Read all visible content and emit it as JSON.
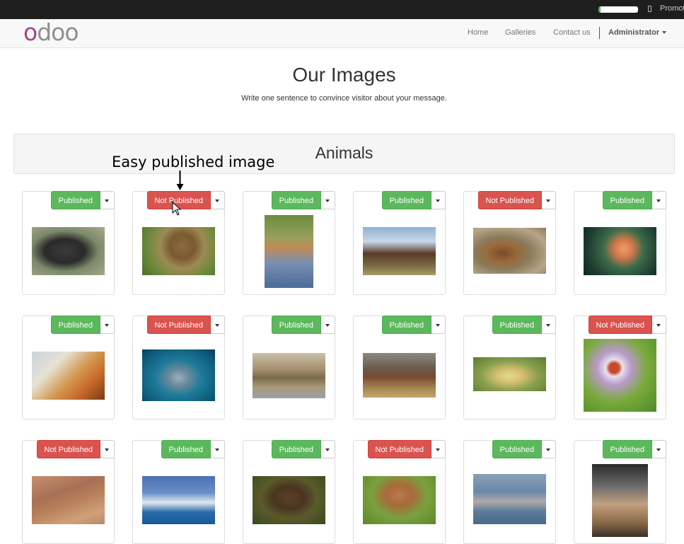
{
  "topbar": {
    "promote_label": "Promot"
  },
  "navbar": {
    "logo": "odoo",
    "items": [
      {
        "label": "Home"
      },
      {
        "label": "Galleries"
      },
      {
        "label": "Contact us"
      }
    ],
    "user": "Administrator"
  },
  "page": {
    "title": "Our Images",
    "subtitle": "Write one sentence to convince visitor about your message."
  },
  "section": {
    "title": "Animals"
  },
  "annotation": {
    "text": "Easy published image"
  },
  "status_labels": {
    "published": "Published",
    "not_published": "Not Published"
  },
  "colors": {
    "published": "#5cb85c",
    "not_published": "#d9534f",
    "logo_accent": "#a24689"
  },
  "images": [
    {
      "subject": "gorilla",
      "status": "Published"
    },
    {
      "subject": "monkey on lion",
      "status": "Not Published"
    },
    {
      "subject": "antelope in water",
      "status": "Published"
    },
    {
      "subject": "highland cattle",
      "status": "Published"
    },
    {
      "subject": "bears in water",
      "status": "Not Published"
    },
    {
      "subject": "tropical fish",
      "status": "Published"
    },
    {
      "subject": "dogs painting",
      "status": "Published"
    },
    {
      "subject": "dolphin",
      "status": "Not Published"
    },
    {
      "subject": "ducks",
      "status": "Published"
    },
    {
      "subject": "horses",
      "status": "Published"
    },
    {
      "subject": "ducklings",
      "status": "Published"
    },
    {
      "subject": "ladybug on flower",
      "status": "Not Published"
    },
    {
      "subject": "meerkat",
      "status": "Not Published"
    },
    {
      "subject": "penguin",
      "status": "Published"
    },
    {
      "subject": "deer stag",
      "status": "Published"
    },
    {
      "subject": "fawn",
      "status": "Not Published"
    },
    {
      "subject": "cygnet",
      "status": "Published"
    },
    {
      "subject": "curlew bird",
      "status": "Published"
    }
  ]
}
